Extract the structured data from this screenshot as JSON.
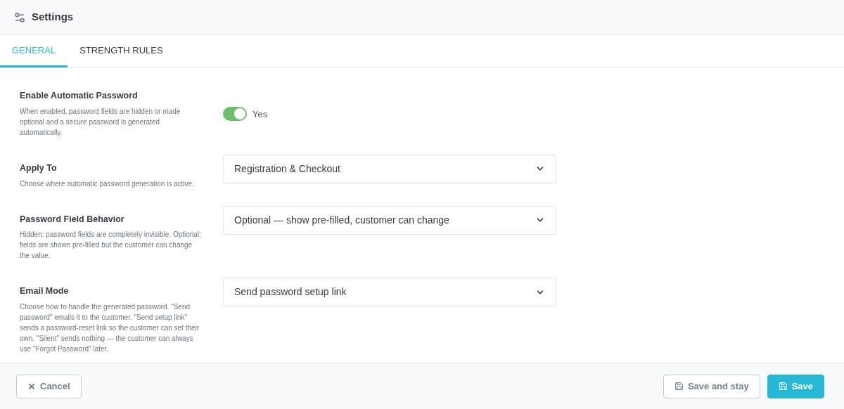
{
  "header": {
    "title": "Settings"
  },
  "tabs": [
    {
      "label": "GENERAL",
      "selected": true
    },
    {
      "label": "STRENGTH RULES",
      "selected": false
    }
  ],
  "fields": [
    {
      "kind": "switch",
      "label": "Enable Automatic Password",
      "description": "When enabled, password fields are hidden or made optional and a secure password is generated automatically.",
      "on": true,
      "value": "Yes"
    },
    {
      "kind": "select",
      "label": "Apply To",
      "description": "Choose where automatic password generation is active.",
      "value": "Registration & Checkout"
    },
    {
      "kind": "select",
      "label": "Password Field Behavior",
      "description": "Hidden: password fields are completely invisible. Optional: fields are shown pre-filled but the customer can change the value.",
      "value": "Optional — show pre-filled, customer can change"
    },
    {
      "kind": "select",
      "label": "Email Mode",
      "description": "Choose how to handle the generated password. \"Send password\" emails it to the customer. \"Send setup link\" sends a password-reset link so the customer can set their own. \"Silent\" sends nothing — the customer can always use \"Forgot Password\" later.",
      "value": "Send password setup link"
    }
  ],
  "footer": {
    "buttons": [
      {
        "kind": "cancel",
        "label": "Cancel"
      },
      {
        "kind": "secondary",
        "label": "Save and stay"
      },
      {
        "kind": "primary",
        "label": "Save"
      }
    ]
  }
}
